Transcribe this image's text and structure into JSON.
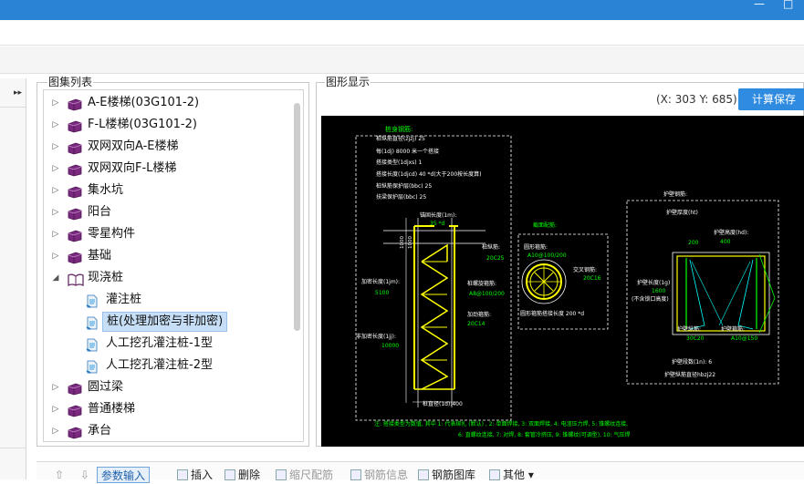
{
  "window": {
    "minimize_glyph": "—",
    "maximize_glyph": "□"
  },
  "left_strip": {
    "collapse_glyph": "▸▸"
  },
  "tree_panel": {
    "title": "图集列表",
    "items": [
      {
        "label": "A-E楼梯(03G101-2)",
        "level": 0,
        "expanded": false,
        "icon": "book-icon"
      },
      {
        "label": "F-L楼梯(03G101-2)",
        "level": 0,
        "expanded": false,
        "icon": "book-icon"
      },
      {
        "label": "双网双向A-E楼梯",
        "level": 0,
        "expanded": false,
        "icon": "book-icon"
      },
      {
        "label": "双网双向F-L楼梯",
        "level": 0,
        "expanded": false,
        "icon": "book-icon"
      },
      {
        "label": "集水坑",
        "level": 0,
        "expanded": false,
        "icon": "book-icon"
      },
      {
        "label": "阳台",
        "level": 0,
        "expanded": false,
        "icon": "book-icon"
      },
      {
        "label": "零星构件",
        "level": 0,
        "expanded": false,
        "icon": "book-icon"
      },
      {
        "label": "基础",
        "level": 0,
        "expanded": false,
        "icon": "book-icon"
      },
      {
        "label": "现浇桩",
        "level": 0,
        "expanded": true,
        "icon": "open-book-icon"
      },
      {
        "label": "灌注桩",
        "level": 1,
        "icon": "document-icon"
      },
      {
        "label": "桩(处理加密与非加密)",
        "level": 1,
        "icon": "document-icon",
        "selected": true
      },
      {
        "label": "人工挖孔灌注桩-1型",
        "level": 1,
        "icon": "document-icon"
      },
      {
        "label": "人工挖孔灌注桩-2型",
        "level": 1,
        "icon": "document-icon"
      },
      {
        "label": "圆过梁",
        "level": 0,
        "expanded": false,
        "icon": "book-icon"
      },
      {
        "label": "普通楼梯",
        "level": 0,
        "expanded": false,
        "icon": "book-icon"
      },
      {
        "label": "承台",
        "level": 0,
        "expanded": false,
        "icon": "book-icon"
      }
    ]
  },
  "graph_panel": {
    "title": "图形显示",
    "coords": "(X: 303 Y: 685)",
    "calc_save_label": "计算保存"
  },
  "drawing": {
    "body_section": {
      "title": "桩身钢筋:",
      "lines": [
        "桩纵筋直径(zjzj) 25",
        "每(1dj) 8000 米一个搭接",
        "搭接类型(1djxs) 1",
        "搭接长度(1djcd) 40 *d(大于200按长度算)",
        "桩纵筋保护层(bbc) 25",
        "扶梁保护层(bbc) 25"
      ]
    },
    "anchor_label": "锚固长度(1m):",
    "anchor_value": "35 *d",
    "bar_label": "桩纵筋:",
    "bar_value": "20C25",
    "spiral_label": "桩螺旋箍筋:",
    "spiral_value": "A8@100/200",
    "stirrup_label": "加劲箍筋:",
    "stirrup_value": "20C14",
    "dense_len_label": "加密长度(1jm):",
    "dense_len_value": "5100",
    "loose_len_label": "非加密长度(1jj):",
    "loose_len_value": "10000",
    "dim_left": "1000",
    "dim_left2": "1000",
    "pile_dia": "桩直径(1d):400",
    "section": {
      "title": "截面配筋:",
      "ring_label": "圆形箍筋:",
      "ring_value": "A10@100/200",
      "cross_label": "交叉钢筋:",
      "cross_value": "20C16",
      "ring_lap": "圆形箍筋搭接长度 200 *d"
    },
    "wall": {
      "title": "护壁钢筋:",
      "thick_label": "护壁厚度(ht)",
      "thick_value": "200",
      "height_label": "护壁高度(hd):",
      "height_value": "400",
      "len_label": "护壁长度(1g)",
      "len_value": "1600",
      "len_note": "(不含锁口高度)",
      "vert_label": "护壁纵筋:",
      "vert_value": "30C20",
      "hoop_label": "护壁箍筋:",
      "hoop_value": "A10@150",
      "count_text": "护壁段数(1n): 6",
      "dia_text": "护壁纵筋直径hbzj22"
    },
    "note1": "注: 搭接类型为数值, 其中 1: 代表绑扎 (默认) , 2: 单面焊接, 3: 双面焊接, 4: 电渣压力焊, 5: 锥螺纹连接,",
    "note2": "6: 直螺纹连接, 7: 对焊, 8: 套管冷挤压, 9: 锥螺纹(可调型), 10: 气压焊"
  },
  "toolbar": {
    "param_input": "参数输入",
    "insert": "插入",
    "delete": "删除",
    "scale": "缩尺配筋",
    "rebar_info": "钢筋信息",
    "rebar_lib": "钢筋图库",
    "other": "其他"
  },
  "colors": {
    "accent": "#2e8be0",
    "cad_green": "#00ff00",
    "cad_yellow": "#ffff00",
    "cad_cyan": "#00ffff",
    "cad_white": "#ffffff"
  }
}
